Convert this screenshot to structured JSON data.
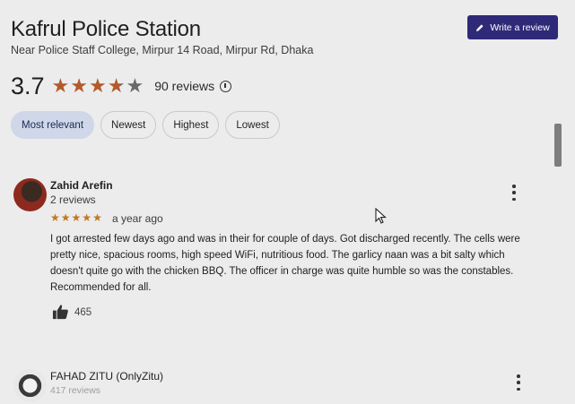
{
  "place": {
    "name": "Kafrul Police Station",
    "address": "Near Police Staff College, Mirpur 14 Road, Mirpur Rd, Dhaka",
    "write_review_label": "Write a review",
    "rating": "3.7",
    "stars": 3.7,
    "review_count_label": "90 reviews"
  },
  "filters": [
    {
      "label": "Most relevant",
      "active": true
    },
    {
      "label": "Newest",
      "active": false
    },
    {
      "label": "Highest",
      "active": false
    },
    {
      "label": "Lowest",
      "active": false
    }
  ],
  "reviews": [
    {
      "name": "Zahid Arefin",
      "meta": "2 reviews",
      "stars": 5,
      "date": "a year ago",
      "text": "I got arrested few days ago and was in their for couple of days. Got discharged recently. The cells were pretty nice, spacious rooms, high speed WiFi, nutritious food. The garlicy naan was a bit salty which doesn't quite go with the chicken BBQ. The officer in charge was quite humble so was the constables. Recommended for all.",
      "likes": "465"
    },
    {
      "name": "FAHAD ZITU (OnlyZitu)",
      "meta": "417 reviews"
    }
  ],
  "colors": {
    "accent_button": "#2e2a78",
    "star": "#b45a2a",
    "active_chip": "#cfd7e8"
  }
}
